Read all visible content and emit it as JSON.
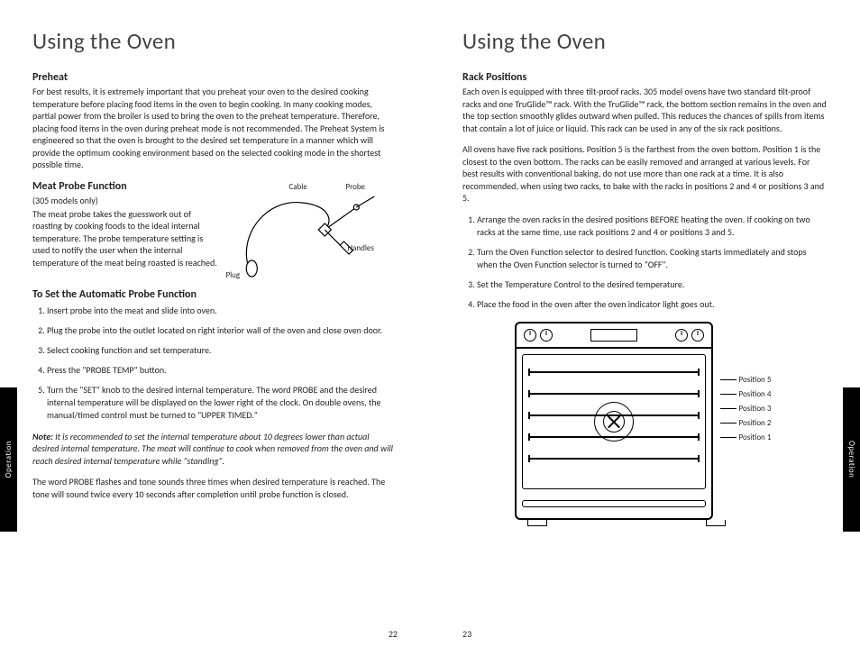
{
  "side_tab": {
    "label": "Operation"
  },
  "left": {
    "title": "Using the Oven",
    "page_number": "22",
    "preheat": {
      "heading": "Preheat",
      "body": "For best results, it is extremely important that you preheat your oven to the desired cooking temperature before placing food items in the oven to begin cooking. In many cooking modes, partial power from the broiler is used to bring the oven to the preheat temperature. Therefore, placing food items in the oven during preheat mode is not recommended. The Preheat System is engineered so that the oven is brought to the desired set temperature in a manner which will provide the optimum cooking environment based on the selected cooking mode in the shortest possible time."
    },
    "probe": {
      "heading": "Meat Probe Function",
      "note": "(305 models only)",
      "body": "The meat probe takes the guesswork out of roasting by cooking foods to the ideal internal temperature. The probe temperature setting is used to notify the user when the internal temperature of the meat being roasted is reached.",
      "labels": {
        "cable": "Cable",
        "probe": "Probe",
        "handles": "Handles",
        "plug": "Plug"
      }
    },
    "auto_probe": {
      "heading": "To Set the Automatic Probe Function",
      "steps": [
        "Insert probe into the meat and slide into oven.",
        "Plug the probe into the outlet located on right interior wall of the oven and close oven door.",
        "Select cooking function and set temperature.",
        "Press the \"PROBE TEMP\" button.",
        "Turn the \"SET\" knob to the desired internal temperature. The word PROBE and the desired internal temperature will be displayed on the lower right of the clock. On double ovens, the manual/timed control must be turned to \"UPPER TIMED.\""
      ],
      "note_label": "Note:",
      "note_body": " It is recommended to set the internal temperature about 10 degrees lower than actual desired internal temperature. The meat will continue to cook when removed from the oven and will reach desired internal temperature while \"standing\".",
      "closing": "The word PROBE flashes and tone sounds three times when desired temperature is reached. The tone will sound twice every 10 seconds after completion until probe function is closed."
    }
  },
  "right": {
    "title": "Using the Oven",
    "page_number": "23",
    "racks": {
      "heading": "Rack Positions",
      "p1": "Each oven is equipped with three tilt-proof racks. 305 model ovens have two standard tilt-proof racks and one TruGlide™ rack. With the TruGlide™ rack, the bottom section remains in the oven and the top section smoothly glides outward when pulled. This reduces the chances of spills from items that contain a lot of juice or liquid. This rack can be used in any of the six rack positions.",
      "p2": "All ovens have five rack positions. Position 5 is the farthest from the oven bottom. Position 1 is the closest to the oven bottom. The racks can be easily removed and arranged at various levels. For best results with conventional baking, do not use more than one rack at a time. It is also recommended, when using two racks, to bake with the racks in positions 2 and 4 or positions 3 and 5.",
      "steps": [
        "Arrange the oven racks in the desired positions BEFORE heating the oven. If cooking on two racks at the same time, use rack positions 2 and 4 or positions 3 and 5.",
        "Turn the Oven Function selector to desired function. Cooking starts immediately and stops when the Oven Function selector is turned to \"OFF\".",
        "Set the Temperature Control to the desired temperature.",
        "Place the food in the oven after the oven indicator light goes out."
      ],
      "pos_labels": [
        "Position 5",
        "Position 4",
        "Position 3",
        "Position 2",
        "Position 1"
      ]
    }
  }
}
